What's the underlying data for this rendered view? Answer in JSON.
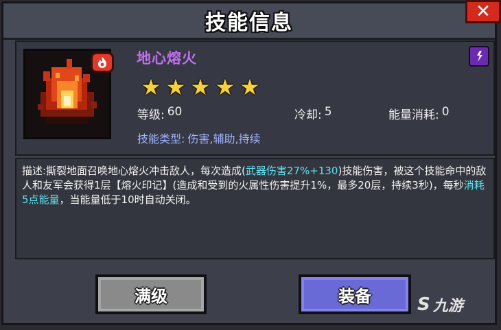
{
  "dialog": {
    "title": "技能信息",
    "close_icon": "close-icon"
  },
  "skill": {
    "name": "地心熔火",
    "stars": 5,
    "level_label": "等级:",
    "level_value": "60",
    "cooldown_label": "冷却:",
    "cooldown_value": "5",
    "energy_label": "能量消耗:",
    "energy_value": "0",
    "type_label": "技能类型:",
    "type_value": "伤害,辅助,持续",
    "icon": "fire-skill-icon",
    "element_badge_icon": "fire-element-icon",
    "rarity_badge_icon": "rarity-icon",
    "name_color": "#c070f0",
    "rarity_color": "#6a2bb0"
  },
  "description": {
    "p1": "描述:撕裂地面召唤地心熔火冲击敌人，每次造成(",
    "h1": "武器伤害27%+130",
    "p2": ")技能伤害，被这个技能命中的敌人和友军会获得1层【熔火印记】(造成和受到的火属性伤害提升1%，最多20层，持续3秒)，每秒",
    "h2": "消耗5点能量",
    "p3": "，当能量低于10时自动关闭。",
    "highlight_color": "#5fe0f0"
  },
  "buttons": {
    "max_label": "满级",
    "equip_label": "装备"
  },
  "watermark": {
    "text": "九游",
    "icon": "nine-game-logo-icon"
  }
}
